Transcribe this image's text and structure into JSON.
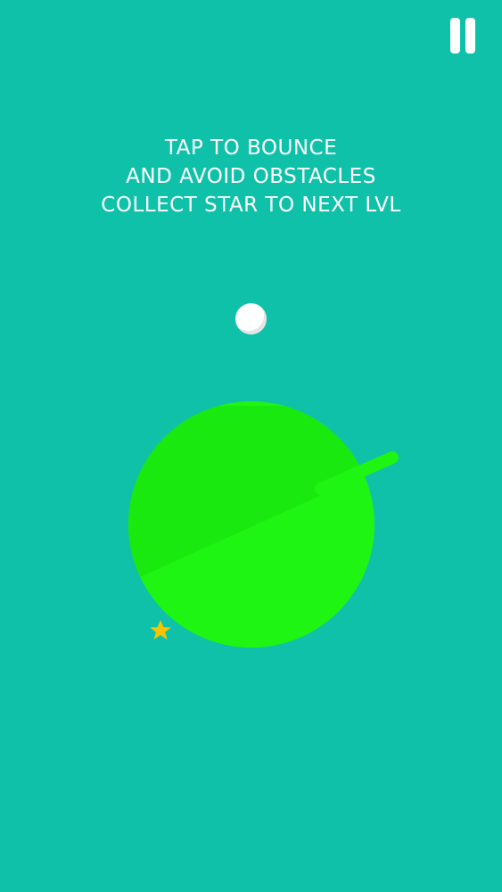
{
  "game": {
    "instructions": [
      "TAP TO BOUNCE",
      "AND AVOID OBSTACLES",
      "COLLECT STAR TO NEXT LVL"
    ],
    "controls": {
      "pause_icon": "pause-icon"
    },
    "colors": {
      "background": "#10c1aa",
      "planet": "#1ff512",
      "planet_shadow": "#19e90f",
      "ball": "#ffffff",
      "star": "#f5c400"
    },
    "icons": {
      "star": "star-icon",
      "ball": "ball"
    }
  }
}
